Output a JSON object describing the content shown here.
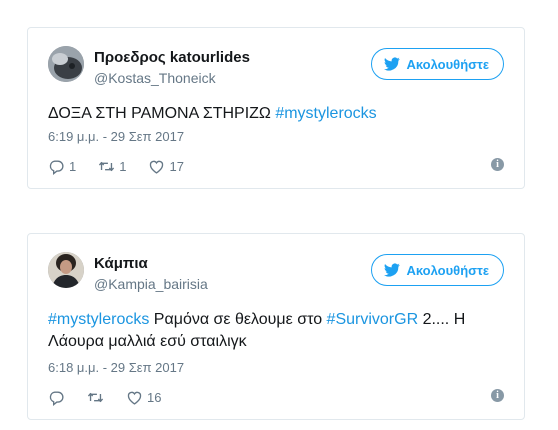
{
  "tweets": [
    {
      "display_name": "Προεδρος katourlides",
      "handle": "@Kostas_Thoneick",
      "follow_label": "Ακολουθήστε",
      "text_plain": "ΔΟΞΑ ΣΤΗ ΡΑΜΟΝΑ ΣΤΗΡΙΖΩ ",
      "hashtag": "#mystylerocks",
      "timestamp": "6:19 μ.μ. - 29 Σεπ 2017",
      "reply_count": "1",
      "retweet_count": "1",
      "like_count": "17",
      "info_icon": "i"
    },
    {
      "display_name": "Κάμπια",
      "handle": "@Kampia_bairisia",
      "follow_label": "Ακολουθήστε",
      "hashtag1": "#mystylerocks",
      "text_part1": " Ραμόνα σε θελουμε στο ",
      "hashtag2": "#SurvivorGR",
      "text_part2": " 2.... Η Λάουρα μαλλιά εσύ σταιλιγκ",
      "timestamp": "6:18 μ.μ. - 29 Σεπ 2017",
      "like_count": "16",
      "info_icon": "i"
    }
  ],
  "colors": {
    "accent": "#1da1f2",
    "hashtag": "#1b95e0",
    "muted": "#657786",
    "border": "#e1e8ed"
  },
  "icons": [
    "twitter-bird-icon",
    "reply-icon",
    "retweet-icon",
    "like-icon",
    "info-icon"
  ]
}
